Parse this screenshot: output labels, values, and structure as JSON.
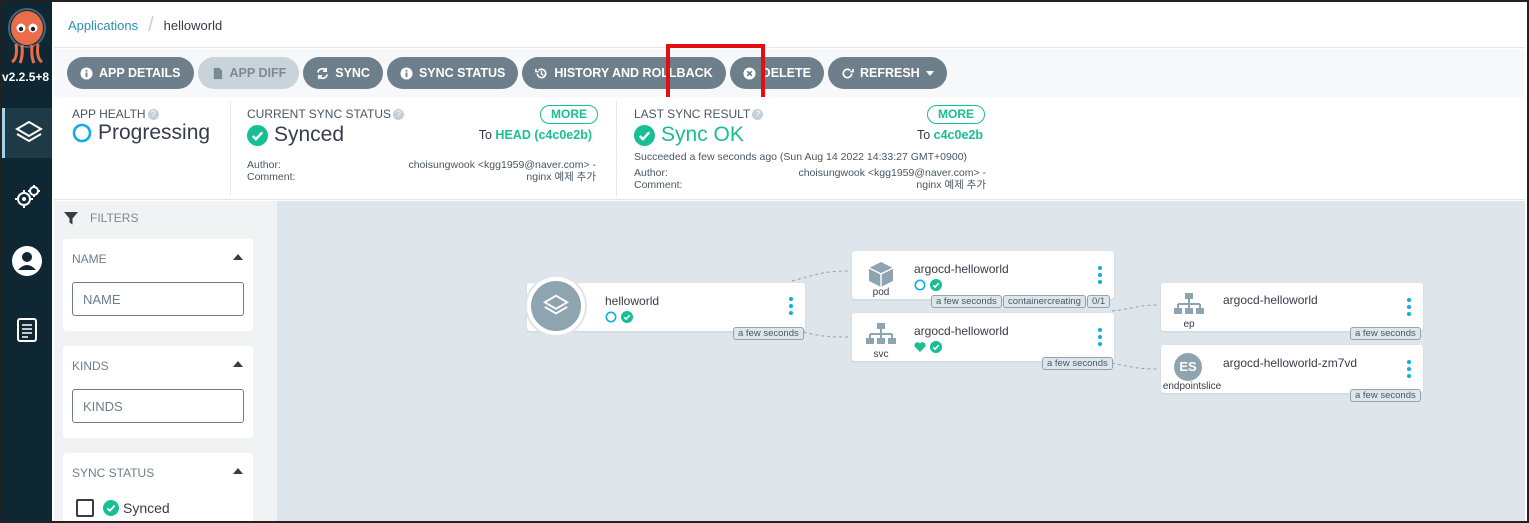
{
  "app": {
    "version": "v2.2.5+8"
  },
  "breadcrumb": {
    "root": "Applications",
    "current": "helloworld"
  },
  "toolbar": {
    "app_details": "APP DETAILS",
    "app_diff": "APP DIFF",
    "sync": "SYNC",
    "sync_status": "SYNC STATUS",
    "history": "HISTORY AND ROLLBACK",
    "delete": "DELETE",
    "refresh": "REFRESH"
  },
  "health": {
    "caption": "APP HEALTH",
    "value": "Progressing"
  },
  "current_sync": {
    "caption": "CURRENT SYNC STATUS",
    "more": "MORE",
    "value": "Synced",
    "to_label": "To",
    "to_value": "HEAD (c4c0e2b)",
    "author_label": "Author:",
    "author_value": "choisungwook <kgg1959@naver.com> -",
    "comment_label": "Comment:",
    "comment_value": "nginx 예제 추가"
  },
  "last_sync": {
    "caption": "LAST SYNC RESULT",
    "more": "MORE",
    "value": "Sync OK",
    "to_label": "To",
    "to_value": "c4c0e2b",
    "succeeded": "Succeeded a few seconds ago (Sun Aug 14 2022 14:33:27 GMT+0900)",
    "author_label": "Author:",
    "author_value": "choisungwook <kgg1959@naver.com> -",
    "comment_label": "Comment:",
    "comment_value": "nginx 예제 추가"
  },
  "filters": {
    "title": "FILTERS",
    "name_head": "NAME",
    "name_placeholder": "NAME",
    "kinds_head": "KINDS",
    "kinds_placeholder": "KINDS",
    "sync_head": "SYNC STATUS",
    "synced_label": "Synced"
  },
  "graph": {
    "root": {
      "name": "helloworld",
      "age": "a few seconds"
    },
    "pod": {
      "name": "argocd-helloworld",
      "kind": "pod",
      "tags": [
        "a few seconds",
        "containercreating",
        "0/1"
      ]
    },
    "svc": {
      "name": "argocd-helloworld",
      "kind": "svc",
      "age": "a few seconds"
    },
    "ep": {
      "name": "argocd-helloworld",
      "kind": "ep",
      "age": "a few seconds"
    },
    "eps": {
      "name": "argocd-helloworld-zm7vd",
      "kind": "endpointslice",
      "icon_text": "ES",
      "age": "a few seconds"
    }
  },
  "colors": {
    "accent": "#18be94",
    "link": "#2c8fb8",
    "nav": "#0f2733",
    "highlight": "#e01010",
    "progress": "#0dadea"
  }
}
